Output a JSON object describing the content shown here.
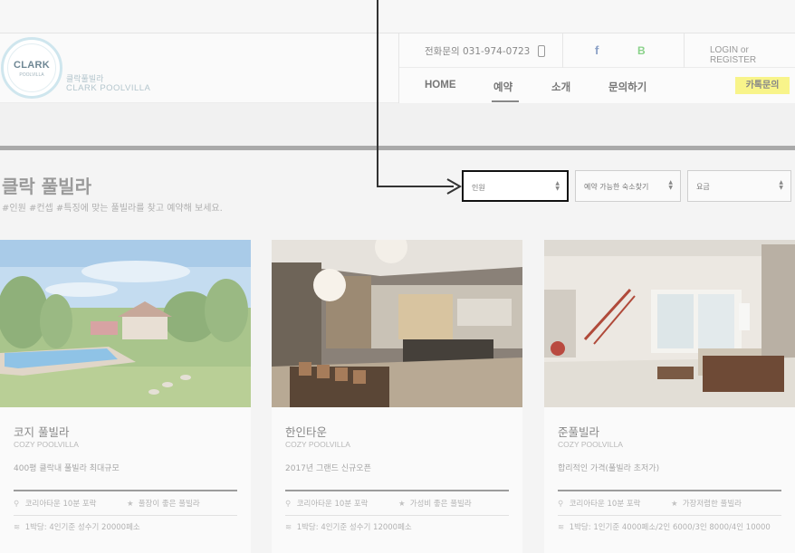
{
  "header": {
    "phone": "전화문의 031-974-0723",
    "login": "LOGIN or REGISTER",
    "brand_kr": "클락풀빌라",
    "brand_en": "CLARK POOLVILLA",
    "logo_text": "CLARK",
    "logo_sub": "POOLVILLA",
    "facebook": "f",
    "blog": "B",
    "nav": [
      "HOME",
      "예약",
      "소개",
      "문의하기"
    ],
    "active_nav": "예약",
    "kakao": "카톡문의"
  },
  "page": {
    "title": "클락 풀빌라",
    "subtitle": "#인원 #컨셉 #특징에 맞는 풀빌라를 찾고 예약해 보세요."
  },
  "filters": [
    {
      "label": "인원",
      "highlighted": true
    },
    {
      "label": "예약 가능한 숙소찾기"
    },
    {
      "label": "요금"
    }
  ],
  "cards": [
    {
      "title": "코지 풀빌라",
      "en": "COZY POOLVILLA",
      "desc": "400평 클락내 풀빌라 최대규모",
      "location": "코리아타운 10분 포락",
      "feature": "풀장이 좋은 풀빌라",
      "price": "1박당: 4인기준 성수기 20000페소"
    },
    {
      "title": "한인타운",
      "en": "COZY POOLVILLA",
      "desc": "2017년 그랜드 신규오픈",
      "location": "코리아타운 10분 포락",
      "feature": "가성비 좋은 풀빌라",
      "price": "1박당: 4인기준 성수기 12000페소"
    },
    {
      "title": "준풀빌라",
      "en": "COZY POOLVILLA",
      "desc": "합리적인 가격(풀빌라 초저가)",
      "location": "코리아타운 10분 포락",
      "feature": "가장저렴한 풀빌라",
      "price": "1박당: 1인기준 4000페소/2인 6000/3인 8000/4인 10000"
    }
  ],
  "colors": {
    "kakao": "#f8f48a",
    "divider": "#a9a9a9",
    "highlight_border": "#111111"
  }
}
